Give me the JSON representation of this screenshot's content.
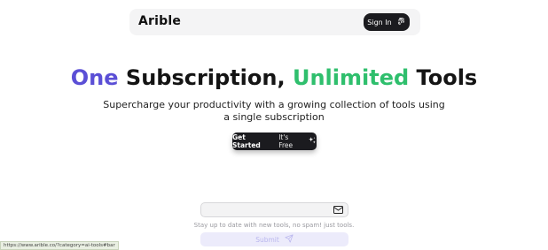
{
  "navbar": {
    "brand": "Arible",
    "sign_in_label": "Sign In",
    "sign_in_icon": "fingerprint-icon"
  },
  "hero": {
    "title_part1": "One",
    "title_part2": "Subscription,",
    "title_part3": "Unlimited",
    "title_part4": "Tools",
    "subtitle_line1": "Supercharge your productivity with a growing collection of tools using",
    "subtitle_line2": "a single subscription",
    "cta_bold": "Get Started",
    "cta_light": "It's Free",
    "cta_icon": "sparkle-icon"
  },
  "newsletter": {
    "email_value": "",
    "email_icon": "mail-icon",
    "hint": "Stay up to date with new tools, no spam! just tools.",
    "submit_label": "Submit",
    "submit_icon": "send-icon"
  },
  "status_bar": {
    "url": "https://www.arible.co/?category=ai-tools#bar"
  },
  "colors": {
    "accent_purple": "#5b4fd6",
    "accent_green": "#2fbf6d",
    "dark_button": "#1b1b1f",
    "submit_bg": "#ecebfb"
  }
}
